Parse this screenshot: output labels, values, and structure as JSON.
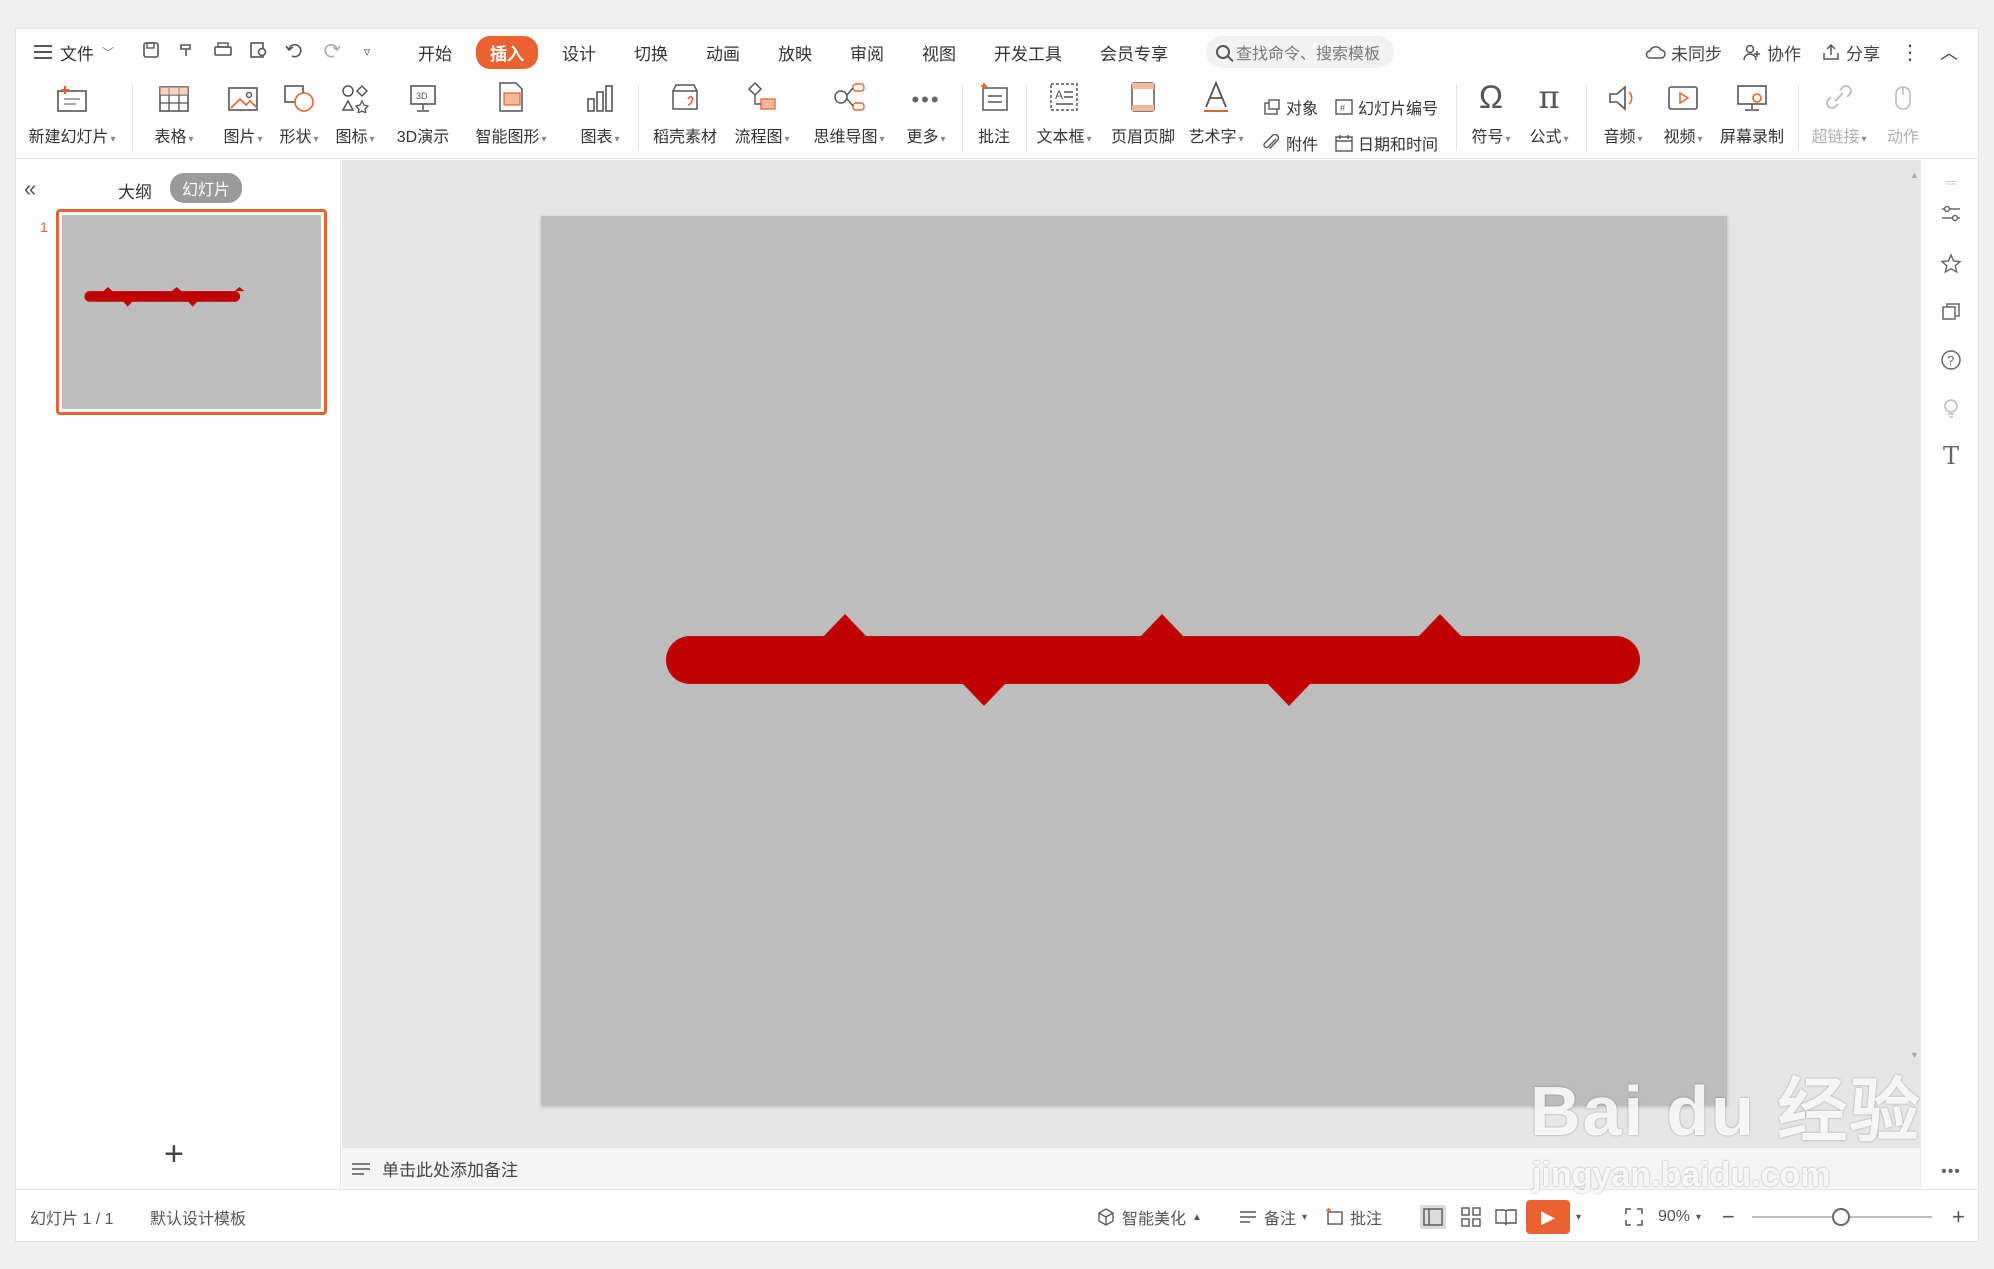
{
  "menubar": {
    "file_label": "文件",
    "tabs": [
      "开始",
      "插入",
      "设计",
      "切换",
      "动画",
      "放映",
      "审阅",
      "视图",
      "开发工具",
      "会员专享"
    ],
    "active_tab": "插入",
    "search_placeholder": "查找命令、搜索模板",
    "sync_label": "未同步",
    "collab_label": "协作",
    "share_label": "分享"
  },
  "ribbon": {
    "new_slide": "新建幻灯片",
    "table": "表格",
    "picture": "图片",
    "shape": "形状",
    "icon": "图标",
    "demo3d": "3D演示",
    "smartart": "智能图形",
    "chart": "图表",
    "docer": "稻壳素材",
    "flowchart": "流程图",
    "mindmap": "思维导图",
    "more": "更多",
    "comment": "批注",
    "textbox": "文本框",
    "header_footer": "页眉页脚",
    "wordart": "艺术字",
    "object": "对象",
    "slide_number": "幻灯片编号",
    "attachment": "附件",
    "datetime": "日期和时间",
    "symbol": "符号",
    "equation": "公式",
    "audio": "音频",
    "video": "视频",
    "screen_record": "屏幕录制",
    "hyperlink": "超链接",
    "action": "动作"
  },
  "leftpanel": {
    "outline_tab": "大纲",
    "slides_tab": "幻灯片",
    "slide_number": "1",
    "add_symbol": "+"
  },
  "notes": {
    "placeholder": "单击此处添加备注"
  },
  "statusbar": {
    "slide_info": "幻灯片 1 / 1",
    "template": "默认设计模板",
    "beautify": "智能美化",
    "notes": "备注",
    "comments": "批注",
    "zoom": "90%"
  },
  "watermark": {
    "main": "Bai du 经验",
    "sub": "jingyan.baidu.com"
  },
  "colors": {
    "accent": "#e9622f",
    "slide_bg": "#bdbdbd",
    "shape_red": "#c00000"
  }
}
